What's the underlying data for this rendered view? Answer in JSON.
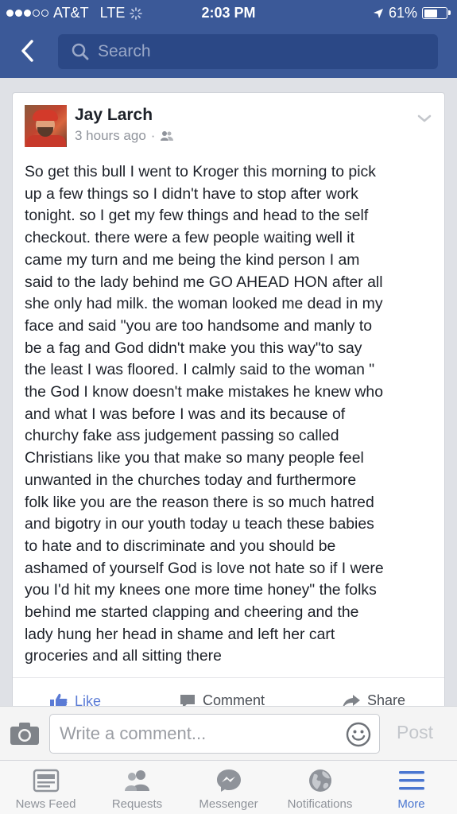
{
  "status_bar": {
    "carrier": "AT&T",
    "network": "LTE",
    "time": "2:03 PM",
    "battery": "61%",
    "battery_level": 0.61,
    "signal_bars_filled": 3,
    "signal_bars_total": 5
  },
  "header": {
    "back_icon": "chevron-left-icon",
    "search_placeholder": "Search",
    "colors": {
      "background": "#3b5998",
      "search_field": "#2b4886"
    }
  },
  "post": {
    "author": "Jay Larch",
    "timestamp": "3 hours ago",
    "separator": "·",
    "audience_icon": "friends-icon",
    "text": "So get this bull  I went to Kroger this  morning to pick\nup a few things so I didn't have to stop after work\ntonight. so I get my few things and head to the self\ncheckout.  there were a few people  waiting  well it\ncame my turn and me being the kind person I am\nsaid to the lady behind me GO AHEAD HON after all\nshe only had milk. the woman looked me dead in my\nface and said \"you are too handsome and manly to\nbe a fag and God didn't make you this way\"to say\nthe least I was floored. I calmly said to the woman \"\nthe God I know doesn't make mistakes he knew who\nand what I was before I was and its because of\nchurchy fake ass judgement passing so called\nChristians like you that make so many people feel\nunwanted  in the churches today and furthermore\nfolk like you are the reason there is so much hatred\nand bigotry in our youth today u teach these babies\nto hate and to discriminate and you should be\nashamed of yourself God is love not hate so if I were\nyou I'd hit my knees one more time honey\" the folks\nbehind me started clapping and cheering and the\nlady hung her head in shame and left her cart\ngroceries and all sitting there",
    "actions": {
      "like": "Like",
      "comment": "Comment",
      "share": "Share"
    }
  },
  "composer": {
    "placeholder": "Write a comment...",
    "post_label": "Post"
  },
  "tabbar": {
    "items": [
      {
        "label": "News Feed",
        "icon": "news-feed-icon"
      },
      {
        "label": "Requests",
        "icon": "friend-requests-icon"
      },
      {
        "label": "Messenger",
        "icon": "messenger-icon"
      },
      {
        "label": "Notifications",
        "icon": "globe-icon"
      },
      {
        "label": "More",
        "icon": "menu-icon",
        "active": true
      }
    ],
    "colors": {
      "active": "#4a76d0",
      "inactive": "#8f939a"
    }
  }
}
